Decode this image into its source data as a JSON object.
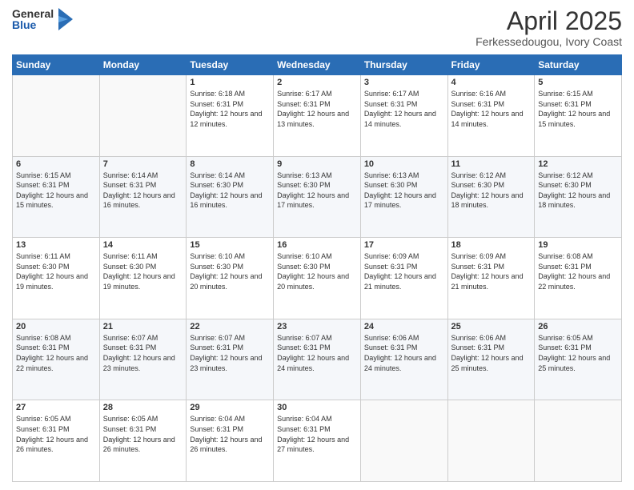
{
  "header": {
    "logo": {
      "general": "General",
      "blue": "Blue"
    },
    "title": "April 2025",
    "location": "Ferkessedougou, Ivory Coast"
  },
  "calendar": {
    "days_of_week": [
      "Sunday",
      "Monday",
      "Tuesday",
      "Wednesday",
      "Thursday",
      "Friday",
      "Saturday"
    ],
    "weeks": [
      [
        {
          "num": "",
          "empty": true
        },
        {
          "num": "",
          "empty": true
        },
        {
          "num": "1",
          "sunrise": "6:18 AM",
          "sunset": "6:31 PM",
          "daylight": "12 hours and 12 minutes."
        },
        {
          "num": "2",
          "sunrise": "6:17 AM",
          "sunset": "6:31 PM",
          "daylight": "12 hours and 13 minutes."
        },
        {
          "num": "3",
          "sunrise": "6:17 AM",
          "sunset": "6:31 PM",
          "daylight": "12 hours and 14 minutes."
        },
        {
          "num": "4",
          "sunrise": "6:16 AM",
          "sunset": "6:31 PM",
          "daylight": "12 hours and 14 minutes."
        },
        {
          "num": "5",
          "sunrise": "6:15 AM",
          "sunset": "6:31 PM",
          "daylight": "12 hours and 15 minutes."
        }
      ],
      [
        {
          "num": "6",
          "sunrise": "6:15 AM",
          "sunset": "6:31 PM",
          "daylight": "12 hours and 15 minutes."
        },
        {
          "num": "7",
          "sunrise": "6:14 AM",
          "sunset": "6:31 PM",
          "daylight": "12 hours and 16 minutes."
        },
        {
          "num": "8",
          "sunrise": "6:14 AM",
          "sunset": "6:30 PM",
          "daylight": "12 hours and 16 minutes."
        },
        {
          "num": "9",
          "sunrise": "6:13 AM",
          "sunset": "6:30 PM",
          "daylight": "12 hours and 17 minutes."
        },
        {
          "num": "10",
          "sunrise": "6:13 AM",
          "sunset": "6:30 PM",
          "daylight": "12 hours and 17 minutes."
        },
        {
          "num": "11",
          "sunrise": "6:12 AM",
          "sunset": "6:30 PM",
          "daylight": "12 hours and 18 minutes."
        },
        {
          "num": "12",
          "sunrise": "6:12 AM",
          "sunset": "6:30 PM",
          "daylight": "12 hours and 18 minutes."
        }
      ],
      [
        {
          "num": "13",
          "sunrise": "6:11 AM",
          "sunset": "6:30 PM",
          "daylight": "12 hours and 19 minutes."
        },
        {
          "num": "14",
          "sunrise": "6:11 AM",
          "sunset": "6:30 PM",
          "daylight": "12 hours and 19 minutes."
        },
        {
          "num": "15",
          "sunrise": "6:10 AM",
          "sunset": "6:30 PM",
          "daylight": "12 hours and 20 minutes."
        },
        {
          "num": "16",
          "sunrise": "6:10 AM",
          "sunset": "6:30 PM",
          "daylight": "12 hours and 20 minutes."
        },
        {
          "num": "17",
          "sunrise": "6:09 AM",
          "sunset": "6:31 PM",
          "daylight": "12 hours and 21 minutes."
        },
        {
          "num": "18",
          "sunrise": "6:09 AM",
          "sunset": "6:31 PM",
          "daylight": "12 hours and 21 minutes."
        },
        {
          "num": "19",
          "sunrise": "6:08 AM",
          "sunset": "6:31 PM",
          "daylight": "12 hours and 22 minutes."
        }
      ],
      [
        {
          "num": "20",
          "sunrise": "6:08 AM",
          "sunset": "6:31 PM",
          "daylight": "12 hours and 22 minutes."
        },
        {
          "num": "21",
          "sunrise": "6:07 AM",
          "sunset": "6:31 PM",
          "daylight": "12 hours and 23 minutes."
        },
        {
          "num": "22",
          "sunrise": "6:07 AM",
          "sunset": "6:31 PM",
          "daylight": "12 hours and 23 minutes."
        },
        {
          "num": "23",
          "sunrise": "6:07 AM",
          "sunset": "6:31 PM",
          "daylight": "12 hours and 24 minutes."
        },
        {
          "num": "24",
          "sunrise": "6:06 AM",
          "sunset": "6:31 PM",
          "daylight": "12 hours and 24 minutes."
        },
        {
          "num": "25",
          "sunrise": "6:06 AM",
          "sunset": "6:31 PM",
          "daylight": "12 hours and 25 minutes."
        },
        {
          "num": "26",
          "sunrise": "6:05 AM",
          "sunset": "6:31 PM",
          "daylight": "12 hours and 25 minutes."
        }
      ],
      [
        {
          "num": "27",
          "sunrise": "6:05 AM",
          "sunset": "6:31 PM",
          "daylight": "12 hours and 26 minutes."
        },
        {
          "num": "28",
          "sunrise": "6:05 AM",
          "sunset": "6:31 PM",
          "daylight": "12 hours and 26 minutes."
        },
        {
          "num": "29",
          "sunrise": "6:04 AM",
          "sunset": "6:31 PM",
          "daylight": "12 hours and 26 minutes."
        },
        {
          "num": "30",
          "sunrise": "6:04 AM",
          "sunset": "6:31 PM",
          "daylight": "12 hours and 27 minutes."
        },
        {
          "num": "",
          "empty": true
        },
        {
          "num": "",
          "empty": true
        },
        {
          "num": "",
          "empty": true
        }
      ]
    ]
  }
}
